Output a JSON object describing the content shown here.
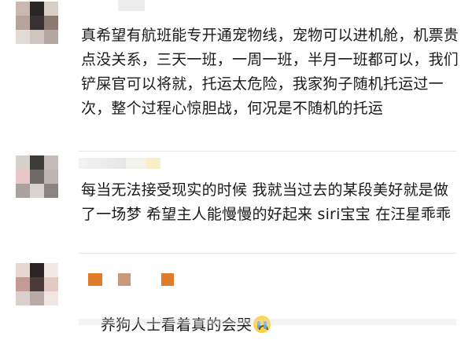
{
  "comments": [
    {
      "text": "真希望有航班能专开通宠物线，宠物可以进机舱，机票贵点没关系，三天一班，一周一班，半月一班都可以，我们铲屎官可以将就，托运太危险，我家狗子随机托运过一次，整个过程心惊胆战，何况是不随机的托运",
      "avatar_colors": [
        "#c9b8b0",
        "#2b2626",
        "#d8cfc9",
        "#b7a39b",
        "#3a3232",
        "#8c7a72",
        "#e2dad5",
        "#cfc5bf",
        "#b4a8a2"
      ]
    },
    {
      "text": "每当无法接受现实的时候 我就当过去的某段美好就是做了一场梦 希望主人能慢慢的好起来 siri宝宝 在汪星乖乖",
      "avatar_colors": [
        "#d6d0cc",
        "#3d3a3a",
        "#c4bcb8",
        "#e9c7c9",
        "#6e6a68",
        "#bdb5b1",
        "#a9a29f",
        "#d9d3cf",
        "#8a8583"
      ]
    },
    {
      "text": "养狗人士看着真的会哭",
      "emoji_name": "crying-face-icon",
      "avatar_colors": [
        "#e7d7d2",
        "#2c2424",
        "#f2e9e6",
        "#c49a95",
        "#4a3b39",
        "#e3c9c4",
        "#d9cfcc",
        "#b8aaa6",
        "#f0e7e4"
      ]
    }
  ]
}
